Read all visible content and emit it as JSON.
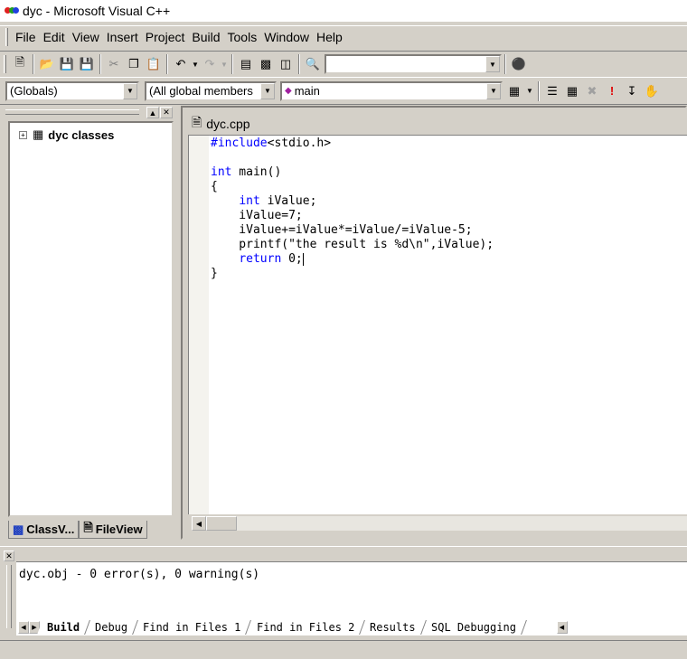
{
  "window": {
    "title": "dyc - Microsoft Visual C++"
  },
  "menu": {
    "items": [
      "File",
      "Edit",
      "View",
      "Insert",
      "Project",
      "Build",
      "Tools",
      "Window",
      "Help"
    ]
  },
  "toolbar": {
    "find_combo_value": "",
    "scope_combo": "(Globals)",
    "members_combo": "(All global members",
    "function_combo": "main"
  },
  "classview": {
    "root_label": "dyc classes",
    "tabs": [
      "ClassV...",
      "FileView"
    ]
  },
  "editor": {
    "filename": "dyc.cpp",
    "lines": [
      [
        {
          "t": "#include",
          "k": true
        },
        {
          "t": "<stdio.h>"
        }
      ],
      [],
      [
        {
          "t": "int",
          "k": true
        },
        {
          "t": " main()"
        }
      ],
      [
        {
          "t": "{"
        }
      ],
      [
        {
          "t": "    "
        },
        {
          "t": "int",
          "k": true
        },
        {
          "t": " iValue;"
        }
      ],
      [
        {
          "t": "    iValue=7;"
        }
      ],
      [
        {
          "t": "    iValue+=iValue*=iValue/=iValue-5;"
        }
      ],
      [
        {
          "t": "    printf(\"the result is %d\\n\",iValue);"
        }
      ],
      [
        {
          "t": "    "
        },
        {
          "t": "return",
          "k": true
        },
        {
          "t": " 0;"
        },
        {
          "caret": true
        }
      ],
      [
        {
          "t": "}"
        }
      ]
    ]
  },
  "output": {
    "text": "dyc.obj - 0 error(s), 0 warning(s)",
    "tabs": [
      "Build",
      "Debug",
      "Find in Files 1",
      "Find in Files 2",
      "Results",
      "SQL Debugging"
    ]
  },
  "colors": {
    "keyword": "#0000ff",
    "chrome": "#d4d0c8"
  }
}
